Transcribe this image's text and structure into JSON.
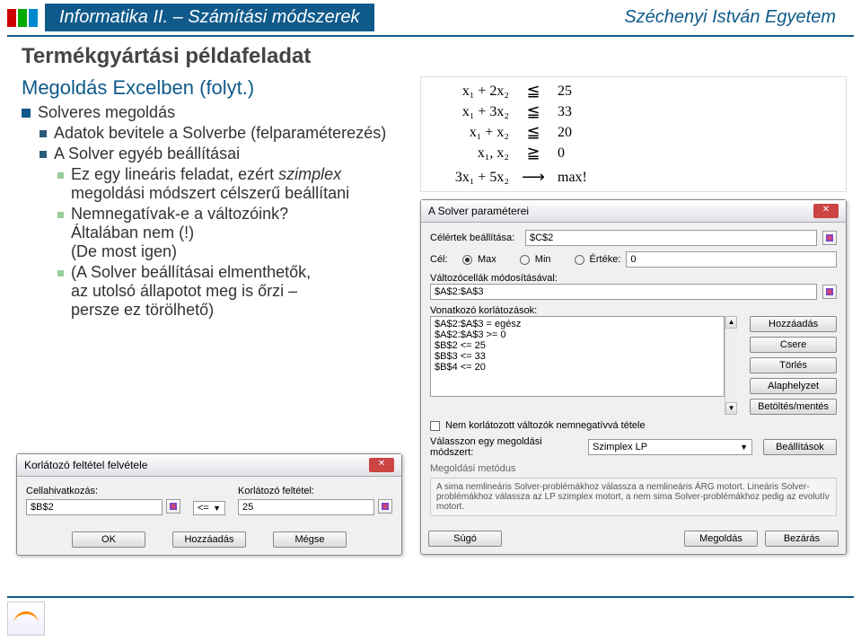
{
  "header": {
    "left_title": "Informatika II. – Számítási módszerek",
    "right_title": "Széchenyi István Egyetem"
  },
  "page_title": "Termékgyártási példafeladat",
  "subtitle": "Megoldás Excelben (folyt.)",
  "bullets": {
    "b1": "Solveres megoldás",
    "b2": "Adatok bevitele a Solverbe (felparaméterezés)",
    "b3": "A Solver egyéb beállításai",
    "b4a": "Ez egy lineáris feladat, ezért ",
    "b4b": "szimplex",
    "b4c": " megoldási módszert célszerű beállítani",
    "b5a": "Nemnegatívak-e a változóink?",
    "b5b": "Általában nem (!)",
    "b5c": "(De most igen)",
    "b6a": "(A Solver beállításai elmenthetők,",
    "b6b": "az utolsó állapotot meg is őrzi –",
    "b6c": "persze ez törölhető)"
  },
  "math": {
    "r1": {
      "lhs": "x₁ + 2x₂",
      "op": "≦",
      "rhs": "25"
    },
    "r2": {
      "lhs": "x₁ + 3x₂",
      "op": "≦",
      "rhs": "33"
    },
    "r3": {
      "lhs": "x₁ + x₂",
      "op": "≦",
      "rhs": "20"
    },
    "r4": {
      "lhs": "x₁, x₂",
      "op": "≧",
      "rhs": "0"
    },
    "r5": {
      "lhs": "3x₁ + 5x₂",
      "op": " ⟶ ",
      "rhs": "max!"
    }
  },
  "solver": {
    "title": "A Solver paraméterei",
    "lbl_target": "Célértek beállítása:",
    "val_target": "$C$2",
    "lbl_goal": "Cél:",
    "opt_max": "Max",
    "opt_min": "Min",
    "opt_val": "Értéke:",
    "val_valinput": "0",
    "lbl_varcells": "Változócellák módosításával:",
    "val_varcells": "$A$2:$A$3",
    "lbl_constraints": "Vonatkozó korlátozások:",
    "constraints": [
      "$A$2:$A$3 = egész",
      "$A$2:$A$3 >= 0",
      "$B$2 <= 25",
      "$B$3 <= 33",
      "$B$4 <= 20"
    ],
    "btn_add": "Hozzáadás",
    "btn_change": "Csere",
    "btn_delete": "Törlés",
    "btn_reset": "Alaphelyzet",
    "btn_loadsave": "Betöltés/mentés",
    "chk_nonneg": "Nem korlátozott változók nemnegatívvá tétele",
    "lbl_method": "Válasszon egy megoldási módszert:",
    "val_method": "Szimplex LP",
    "btn_options": "Beállítások",
    "group_method": "Megoldási metódus",
    "desc_method": "A sima nemlineáris Solver-problémákhoz válassza a nemlineáris ÁRG motort. Lineáris Solver-problémákhoz válassza az LP szimplex motort, a nem sima Solver-problémákhoz pedig az evolutív motort.",
    "btn_help": "Súgó",
    "btn_solve": "Megoldás",
    "btn_close": "Bezárás"
  },
  "constraint_dlg": {
    "title": "Korlátozó feltétel felvétele",
    "lbl_cellref": "Cellahivatkozás:",
    "val_cellref": "$B$2",
    "val_op": "<=",
    "lbl_constraint": "Korlátozó feltétel:",
    "val_constraint": "25",
    "btn_ok": "OK",
    "btn_add": "Hozzáadás",
    "btn_cancel": "Mégse"
  }
}
